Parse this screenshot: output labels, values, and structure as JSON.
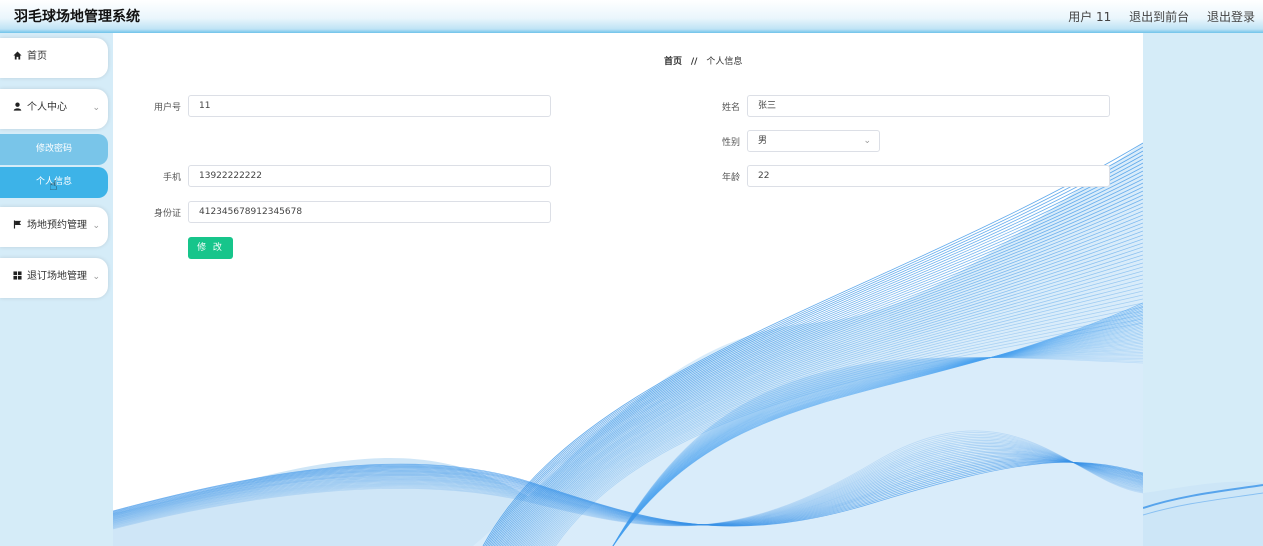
{
  "header": {
    "app_title": "羽毛球场地管理系统",
    "user_info": "用户 11",
    "exit_front": "退出到前台",
    "logout": "退出登录"
  },
  "sidebar": {
    "home": {
      "label": "首页",
      "icon": "home-icon"
    },
    "personal_center": {
      "label": "个人中心",
      "icon": "user-icon"
    },
    "sub_items": {
      "change_password": "修改密码",
      "personal_info": "个人信息"
    },
    "venue_booking": {
      "label": "场地预约管理",
      "icon": "flag-icon"
    },
    "refund_venue": {
      "label": "退订场地管理",
      "icon": "grid-icon"
    }
  },
  "breadcrumb": {
    "home": "首页",
    "separator": "//",
    "current": "个人信息"
  },
  "form": {
    "username": {
      "label": "用户号",
      "value": "11"
    },
    "name": {
      "label": "姓名",
      "value": "张三"
    },
    "gender": {
      "label": "性别",
      "value": "男"
    },
    "phone": {
      "label": "手机",
      "value": "13922222222"
    },
    "age": {
      "label": "年龄",
      "value": "22"
    },
    "id_card": {
      "label": "身份证",
      "value": "412345678912345678"
    },
    "submit_label": "修 改"
  },
  "colors": {
    "accent": "#3db3e8",
    "button": "#17c58b",
    "sidebar_bg": "#d5ecf8",
    "wave": "#2f8fe6"
  }
}
